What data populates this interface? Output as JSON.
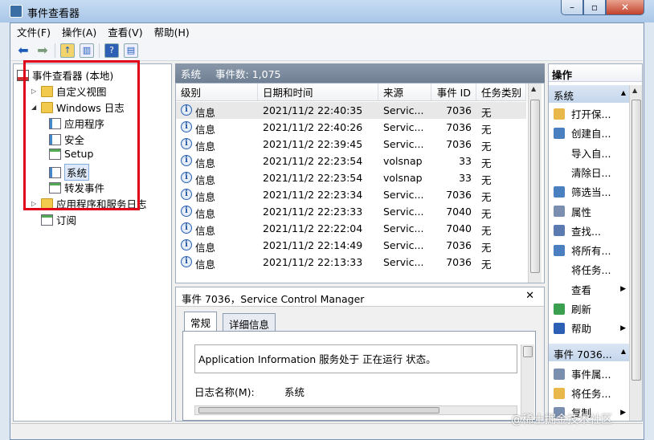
{
  "window": {
    "title": "事件查看器",
    "min": "–",
    "max": "▫",
    "close": "✕"
  },
  "menu": [
    "文件(F)",
    "操作(A)",
    "查看(V)",
    "帮助(H)"
  ],
  "tree": {
    "root": "事件查看器 (本地)",
    "custom_views": "自定义视图",
    "windows_logs": "Windows 日志",
    "application": "应用程序",
    "security": "安全",
    "setup": "Setup",
    "system": "系统",
    "forwarded": "转发事件",
    "app_services": "应用程序和服务日志",
    "subscriptions": "订阅"
  },
  "list": {
    "title": "系统",
    "count": "事件数: 1,075",
    "columns": [
      "级别",
      "日期和时间",
      "来源",
      "事件 ID",
      "任务类别"
    ],
    "rows": [
      {
        "level": "信息",
        "dt": "2021/11/2 22:40:35",
        "src": "Servic...",
        "id": "7036",
        "cat": "无"
      },
      {
        "level": "信息",
        "dt": "2021/11/2 22:40:26",
        "src": "Servic...",
        "id": "7036",
        "cat": "无"
      },
      {
        "level": "信息",
        "dt": "2021/11/2 22:39:45",
        "src": "Servic...",
        "id": "7036",
        "cat": "无"
      },
      {
        "level": "信息",
        "dt": "2021/11/2 22:23:54",
        "src": "volsnap",
        "id": "33",
        "cat": "无"
      },
      {
        "level": "信息",
        "dt": "2021/11/2 22:23:54",
        "src": "volsnap",
        "id": "33",
        "cat": "无"
      },
      {
        "level": "信息",
        "dt": "2021/11/2 22:23:34",
        "src": "Servic...",
        "id": "7036",
        "cat": "无"
      },
      {
        "level": "信息",
        "dt": "2021/11/2 22:23:33",
        "src": "Servic...",
        "id": "7040",
        "cat": "无"
      },
      {
        "level": "信息",
        "dt": "2021/11/2 22:22:04",
        "src": "Servic...",
        "id": "7040",
        "cat": "无"
      },
      {
        "level": "信息",
        "dt": "2021/11/2 22:14:49",
        "src": "Servic...",
        "id": "7036",
        "cat": "无"
      },
      {
        "level": "信息",
        "dt": "2021/11/2 22:13:33",
        "src": "Servic...",
        "id": "7036",
        "cat": "无"
      }
    ]
  },
  "detail": {
    "title": "事件 7036，Service Control Manager",
    "close": "✕",
    "tab_general": "常规",
    "tab_details": "详细信息",
    "description": "Application Information 服务处于 正在运行 状态。",
    "log_name_label": "日志名称(M):",
    "log_name_value": "系统"
  },
  "actions": {
    "header": "操作",
    "section1": "系统",
    "items1": [
      "打开保...",
      "创建自...",
      "导入自...",
      "清除日...",
      "筛选当...",
      "属性",
      "查找...",
      "将所有...",
      "将任务...",
      "查看",
      "刷新",
      "帮助"
    ],
    "section2": "事件 7036...",
    "items2": [
      "事件属...",
      "将任务...",
      "复制"
    ]
  },
  "watermark": "@稀土掘金技术社区"
}
